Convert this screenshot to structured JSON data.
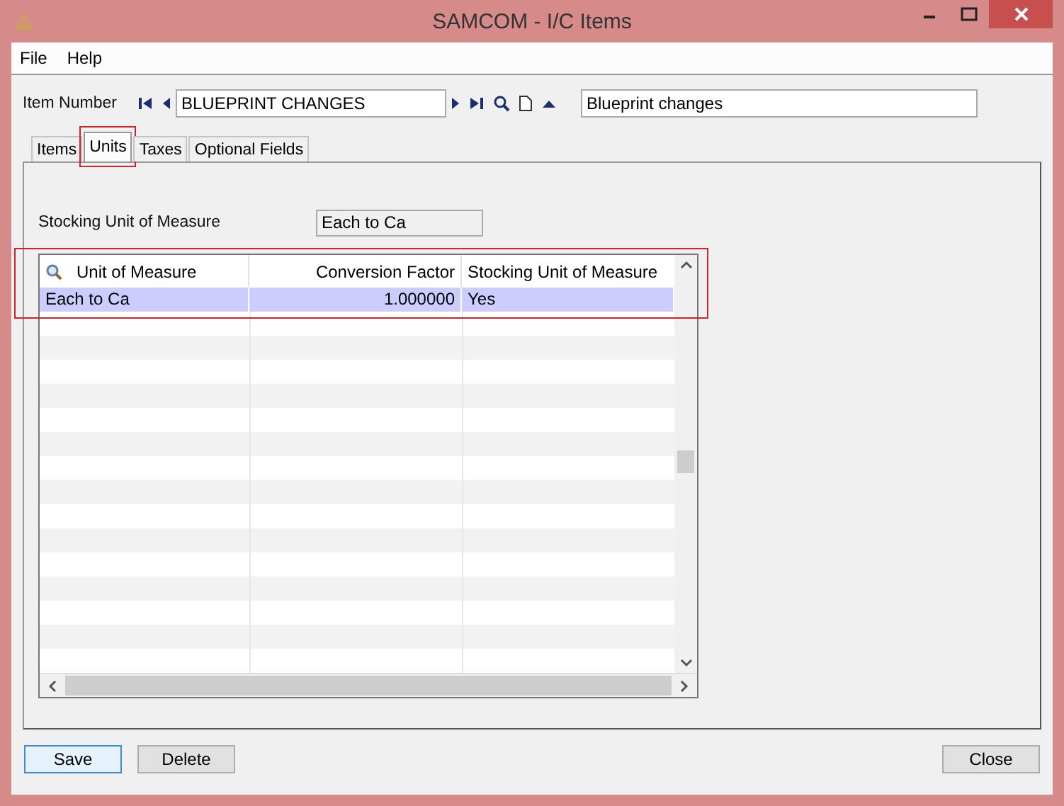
{
  "window": {
    "title": "SAMCOM - I/C Items"
  },
  "menu": [
    "File",
    "Help"
  ],
  "item_number": {
    "label": "Item Number",
    "value": "BLUEPRINT CHANGES",
    "description": "Blueprint changes"
  },
  "tabs": [
    {
      "label": "Items",
      "selected": false,
      "highlighted": false
    },
    {
      "label": "Units",
      "selected": true,
      "highlighted": true
    },
    {
      "label": "Taxes",
      "selected": false,
      "highlighted": false
    },
    {
      "label": "Optional Fields",
      "selected": false,
      "highlighted": false
    }
  ],
  "stocking_unit": {
    "label": "Stocking Unit of Measure",
    "value": "Each to Ca"
  },
  "grid": {
    "highlighted": true,
    "columns": [
      "Unit of Measure",
      "Conversion Factor",
      "Stocking Unit of Measure"
    ],
    "rows": [
      {
        "cells": [
          "Each to Ca",
          "1.000000",
          "Yes"
        ],
        "selected": true
      }
    ]
  },
  "buttons": [
    {
      "label": "Save",
      "kind": "default"
    },
    {
      "label": "Delete",
      "kind": "normal"
    },
    {
      "label": "Close",
      "kind": "normal"
    }
  ]
}
